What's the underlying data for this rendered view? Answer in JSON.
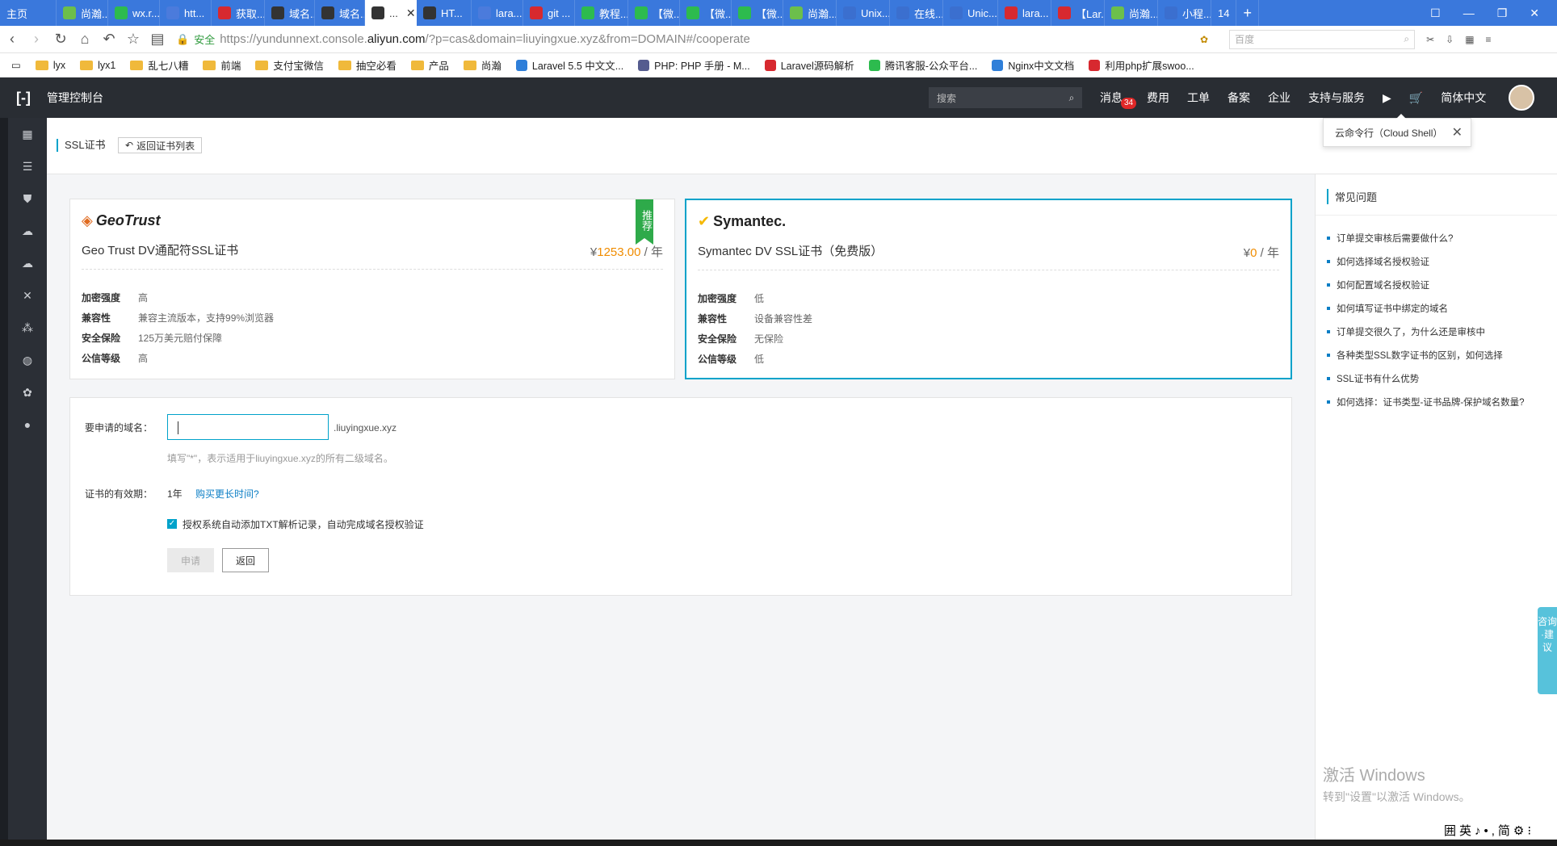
{
  "browser": {
    "tabs": [
      {
        "label": "主页",
        "color": "#3a78dc"
      },
      {
        "label": "尚瀚...",
        "color": "#6cbf4b"
      },
      {
        "label": "wx.r...",
        "color": "#2dbb4e"
      },
      {
        "label": "htt...",
        "color": "#4b7bdc"
      },
      {
        "label": "获取...",
        "color": "#d7292f"
      },
      {
        "label": "域名...",
        "color": "#333"
      },
      {
        "label": "域名...",
        "color": "#333"
      },
      {
        "label": "...",
        "color": "#333"
      },
      {
        "label": "HT...",
        "color": "#333"
      },
      {
        "label": "lara...",
        "color": "#4b7bdc"
      },
      {
        "label": "git ...",
        "color": "#d7292f"
      },
      {
        "label": "教程...",
        "color": "#2dbb4e"
      },
      {
        "label": "【微...",
        "color": "#2dbb4e"
      },
      {
        "label": "【微...",
        "color": "#2dbb4e"
      },
      {
        "label": "【微...",
        "color": "#2dbb4e"
      },
      {
        "label": "尚瀚...",
        "color": "#6cbf4b"
      },
      {
        "label": "Unix...",
        "color": "#3b6fcf"
      },
      {
        "label": "在线...",
        "color": "#3b6fcf"
      },
      {
        "label": "Unic...",
        "color": "#3b6fcf"
      },
      {
        "label": "lara...",
        "color": "#d7292f"
      },
      {
        "label": "【Lar...",
        "color": "#d7292f"
      },
      {
        "label": "尚瀚...",
        "color": "#6cbf4b"
      },
      {
        "label": "小程...",
        "color": "#3b6fcf"
      }
    ],
    "tab_count": "14",
    "address": {
      "secure_label": "安全",
      "url_prefix": "https://yundunnext.console.",
      "url_host": "aliyun.com",
      "url_suffix": "/?p=cas&domain=liuyingxue.xyz&from=DOMAIN#/cooperate",
      "search_placeholder": "百度"
    },
    "bookmarks": [
      {
        "label": "lyx",
        "type": "folder"
      },
      {
        "label": "lyx1",
        "type": "folder"
      },
      {
        "label": "乱七八糟",
        "type": "folder"
      },
      {
        "label": "前端",
        "type": "folder"
      },
      {
        "label": "支付宝微信",
        "type": "folder"
      },
      {
        "label": "抽空必看",
        "type": "folder"
      },
      {
        "label": "产品",
        "type": "folder"
      },
      {
        "label": "尚瀚",
        "type": "folder"
      },
      {
        "label": "Laravel 5.5 中文文...",
        "type": "link",
        "color": "#2f7fd9"
      },
      {
        "label": "PHP: PHP 手册 - M...",
        "type": "link",
        "color": "#555c8f"
      },
      {
        "label": "Laravel源码解析",
        "type": "link",
        "color": "#d7292f"
      },
      {
        "label": "腾讯客服-公众平台...",
        "type": "link",
        "color": "#2dbb4e"
      },
      {
        "label": "Nginx中文文档",
        "type": "link",
        "color": "#2f7fd9"
      },
      {
        "label": "利用php扩展swoo...",
        "type": "link",
        "color": "#d7292f"
      }
    ]
  },
  "topnav": {
    "title": "管理控制台",
    "search_placeholder": "搜索",
    "items": [
      "消息",
      "费用",
      "工单",
      "备案",
      "企业",
      "支持与服务"
    ],
    "message_badge": "34",
    "lang": "简体中文"
  },
  "tooltip": {
    "text": "云命令行（Cloud Shell）"
  },
  "page": {
    "title": "SSL证书",
    "back_button": "返回证书列表"
  },
  "cards": [
    {
      "brand": "GeoTrust",
      "title": "Geo Trust DV通配符SSL证书",
      "price_symbol": "¥",
      "price": "1253.00",
      "price_unit": " / 年",
      "ribbon": "推荐",
      "specs": [
        {
          "k": "加密强度",
          "v": "高",
          "v2": ""
        },
        {
          "k": "兼容性",
          "v": "兼容主流版本，",
          "v2": "支持99%浏览器"
        },
        {
          "k": "安全保险",
          "v": "125万美元",
          "v2": "赔付保障"
        },
        {
          "k": "公信等级",
          "v": "高",
          "v2": ""
        }
      ]
    },
    {
      "brand": "Symantec.",
      "title": "Symantec DV SSL证书（免费版）",
      "price_symbol": "¥",
      "price": "0",
      "price_unit": " / 年",
      "specs": [
        {
          "k": "加密强度",
          "v": "低"
        },
        {
          "k": "兼容性",
          "v": "设备兼容性差"
        },
        {
          "k": "安全保险",
          "v": "无保险"
        },
        {
          "k": "公信等级",
          "v": "低"
        }
      ]
    }
  ],
  "form": {
    "domain_label": "要申请的域名：",
    "domain_value": "",
    "domain_suffix": ".liuyingxue.xyz",
    "domain_hint": "填写\"*\"，表示适用于liuyingxue.xyz的所有二级域名。",
    "term_label": "证书的有效期：",
    "term_value": "1年",
    "term_link": "购买更长时间?",
    "checkbox_label": "授权系统自动添加TXT解析记录，自动完成域名授权验证",
    "checkbox_checked": true,
    "apply_button": "申请",
    "back_button": "返回"
  },
  "faq": {
    "title": "常见问题",
    "items": [
      "订单提交审核后需要做什么?",
      "如何选择域名授权验证",
      "如何配置域名授权验证",
      "如何填写证书中绑定的域名",
      "订单提交很久了，为什么还是审核中",
      "各种类型SSL数字证书的区别，如何选择",
      "SSL证书有什么优势",
      "如何选择：证书类型-证书品牌-保护域名数量?"
    ]
  },
  "advice": {
    "text": "咨询·建议"
  },
  "watermark": {
    "line1": "激活 Windows",
    "line2": "转到\"设置\"以激活 Windows。"
  },
  "ime": {
    "text": "囲英♪•,简⚙⁝"
  }
}
